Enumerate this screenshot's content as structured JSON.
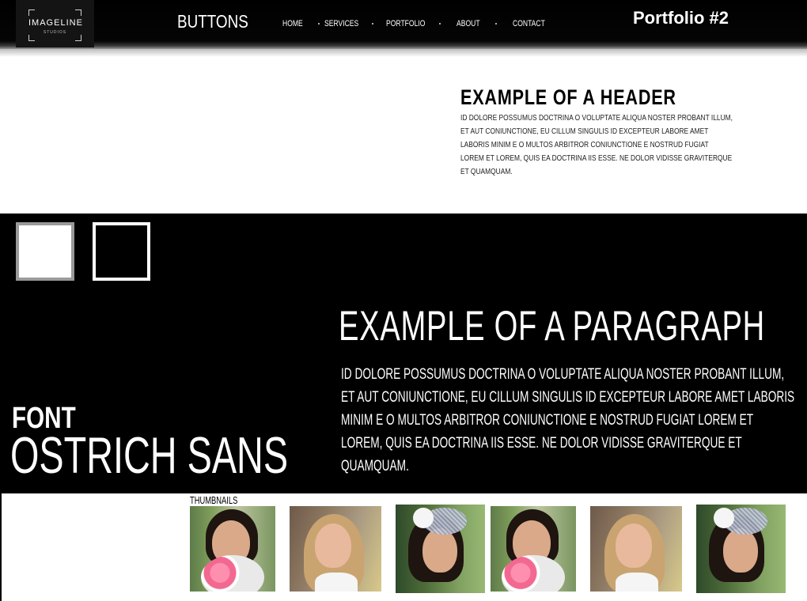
{
  "header": {
    "logo_title": "IMAGELINE",
    "logo_subtitle": "STUDIOS",
    "buttons_label": "BUTTONS",
    "nav": [
      "HOME",
      "SERVICES",
      "PORTFOLIO",
      "ABOUT",
      "CONTACT"
    ],
    "portfolio_title": "Portfolio #2"
  },
  "header_example": {
    "title": "EXAMPLE OF A HEADER",
    "body": " ID DOLORE POSSUMUS DOCTRINA O VOLUPTATE ALIQUA NOSTER PROBANT ILLUM, ET AUT CONIUNCTIONE, EU CILLUM SINGULIS ID EXCEPTEUR LABORE AMET LABORIS MINIM E O MULTOS ARBITROR CONIUNCTIONE E NOSTRUD FUGIAT LOREM ET LOREM, QUIS EA DOCTRINA IIS ESSE. NE DOLOR VIDISSE GRAVITERQUE ET QUAMQUAM."
  },
  "paragraph_example": {
    "title": "EXAMPLE OF A PARAGRAPH",
    "body": " ID DOLORE POSSUMUS DOCTRINA O VOLUPTATE ALIQUA NOSTER PROBANT ILLUM, ET AUT CONIUNCTIONE, EU CILLUM SINGULIS ID EXCEPTEUR LABORE AMET LABORIS MINIM E O MULTOS ARBITROR CONIUNCTIONE E NOSTRUD FUGIAT LOREM ET LOREM, QUIS EA DOCTRINA IIS ESSE. NE DOLOR VIDISSE GRAVITERQUE ET QUAMQUAM."
  },
  "font_info": {
    "label": "FONT",
    "name": "OSTRICH SANS"
  },
  "thumbnails": {
    "label": "THUMBNAILS"
  },
  "colors": {
    "background": "#ffffff",
    "bar": "#000000",
    "text_light": "#ffffff",
    "button_border_gray": "#9a9a9a"
  }
}
